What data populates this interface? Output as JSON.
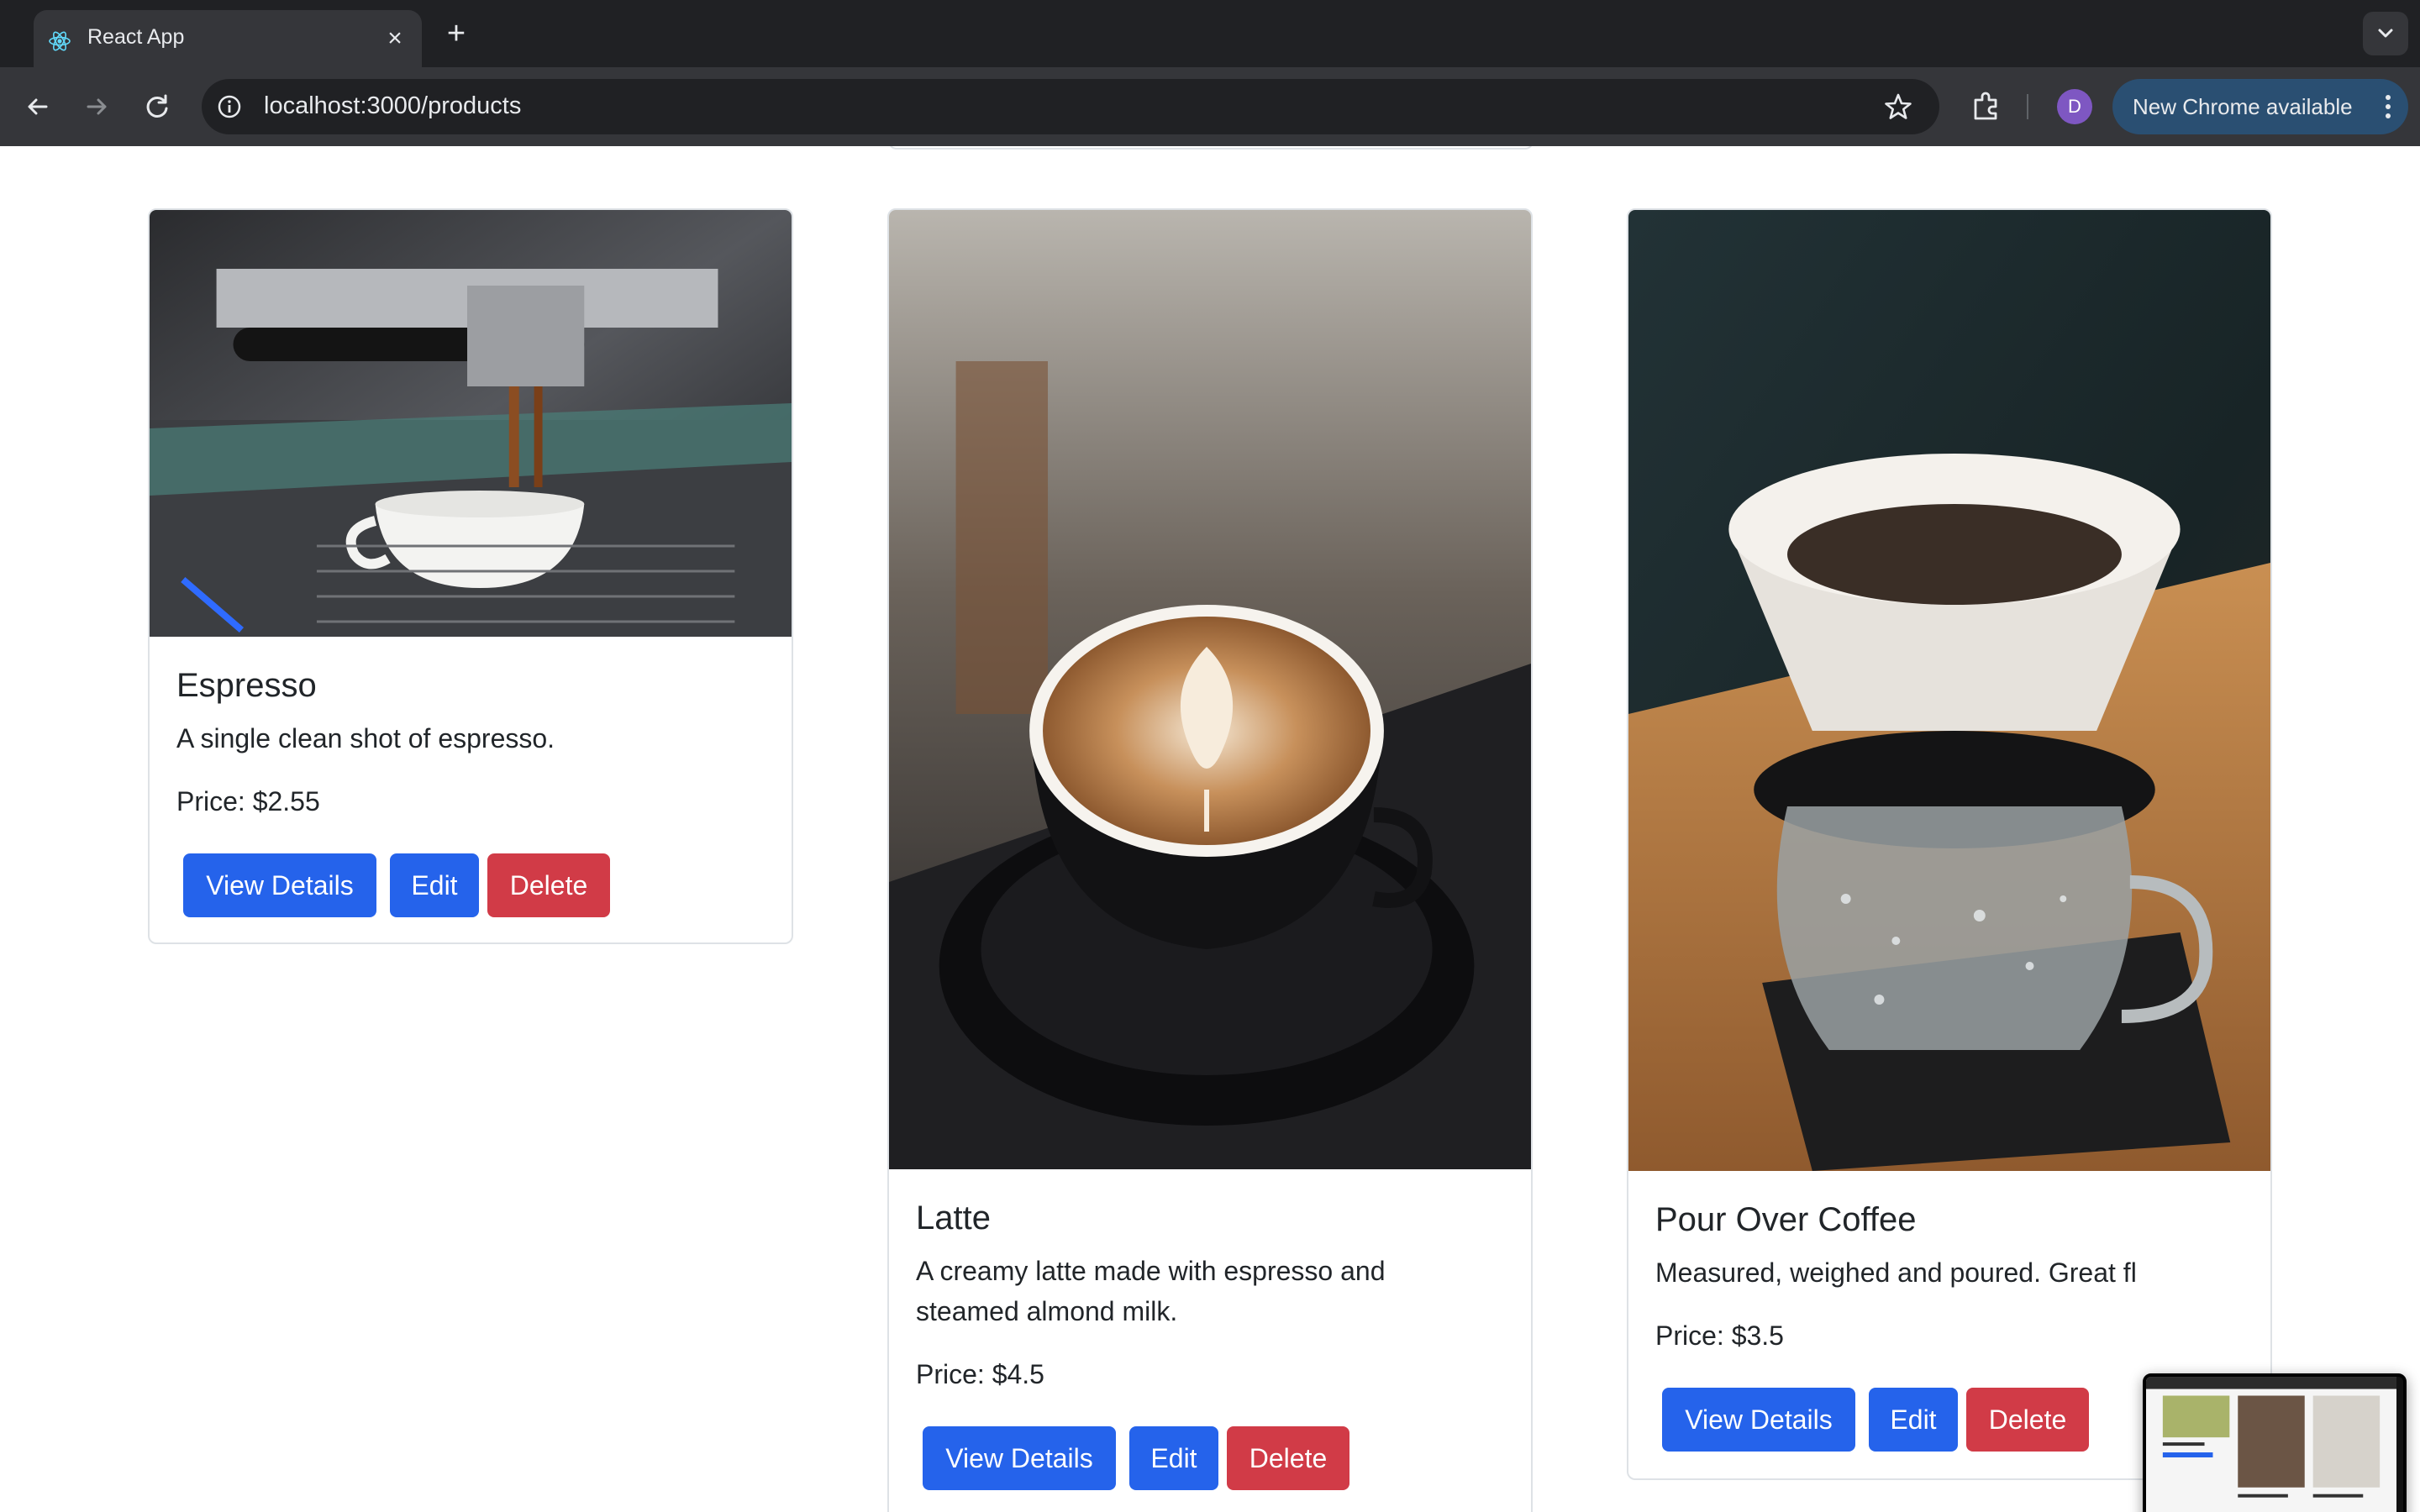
{
  "browser": {
    "tab_title": "React App",
    "url": "localhost:3000/products",
    "profile_initial": "D",
    "update_label": "New Chrome available"
  },
  "products": [
    {
      "name": "Espresso",
      "description": "A single clean shot of espresso.",
      "price": "Price: $2.55",
      "buttons": {
        "view": "View Details",
        "edit": "Edit",
        "delete": "Delete"
      }
    },
    {
      "name": "Latte",
      "description": "A creamy latte made with espresso and steamed almond milk.",
      "price": "Price: $4.5",
      "buttons": {
        "view": "View Details",
        "edit": "Edit",
        "delete": "Delete"
      }
    },
    {
      "name": "Pour Over Coffee",
      "description": "Measured, weighed and poured. Great fl",
      "price": "Price: $3.5",
      "buttons": {
        "view": "View Details",
        "edit": "Edit",
        "delete": "Delete"
      }
    }
  ],
  "colors": {
    "primary": "#2563eb",
    "danger": "#d13b47",
    "card_border": "#dee2e6",
    "chrome_dark": "#202124",
    "chrome_toolbar": "#35363a"
  }
}
